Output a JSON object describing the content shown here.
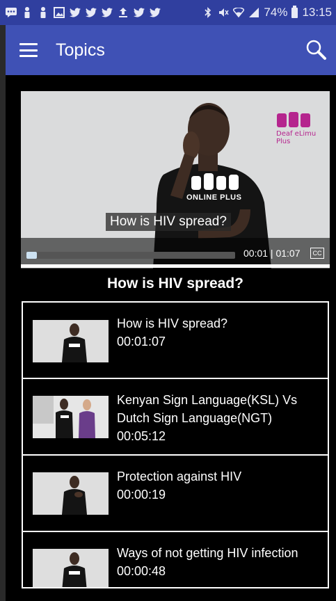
{
  "status_bar": {
    "battery": "74%",
    "time": "13:15"
  },
  "app_bar": {
    "title": "Topics"
  },
  "player": {
    "caption": "How is HIV spread?",
    "brand": "Deaf eLimu Plus",
    "shirt_text": "ONLINE PLUS",
    "time_display": "00:01 | 01:07",
    "cc_label": "CC",
    "progress": 0.05
  },
  "now_playing": {
    "title": "How is HIV spread?"
  },
  "videos": [
    {
      "title": "How is HIV spread?",
      "duration": "00:01:07"
    },
    {
      "title_line1": "Kenyan Sign Language(KSL) Vs",
      "title_line2": "Dutch Sign Language(NGT)",
      "duration": "00:05:12"
    },
    {
      "title": "Protection against HIV",
      "duration": "00:00:19"
    },
    {
      "title": "Ways of not getting HIV infection",
      "duration": "00:00:48"
    }
  ],
  "colors": {
    "status_bar": "#303f9f",
    "app_bar": "#3f51b5",
    "background": "#000000",
    "progress_fill": "#cde2f2"
  }
}
